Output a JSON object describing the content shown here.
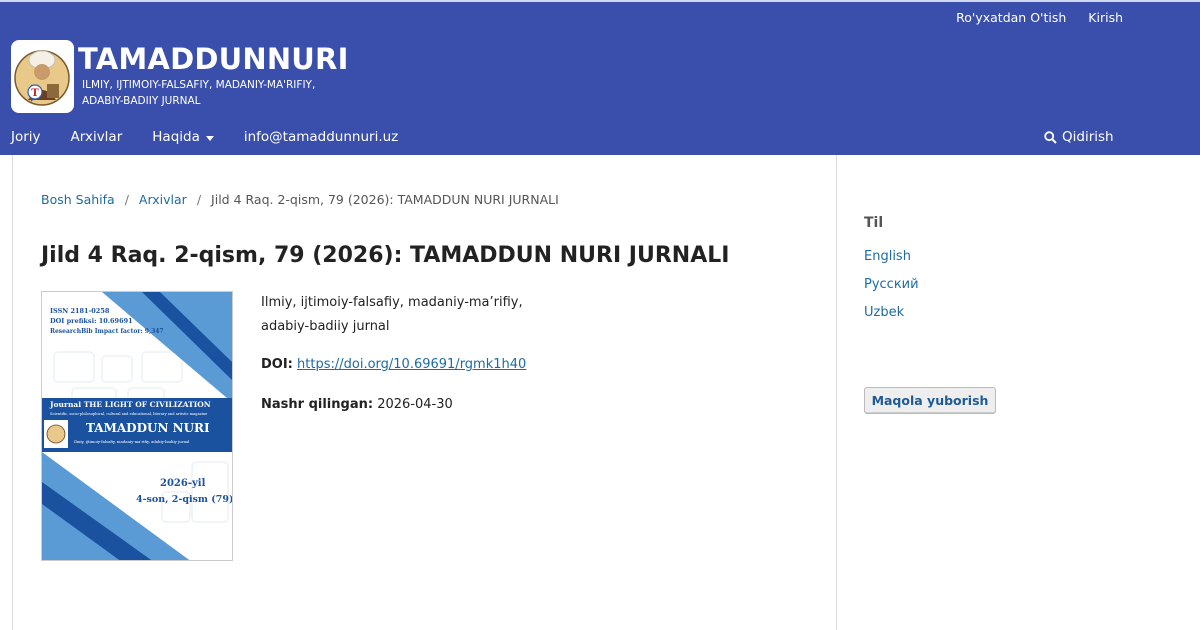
{
  "header": {
    "user_nav": [
      "Ro'yxatdan O'tish",
      "Kirish"
    ],
    "site_title": "TAMADDUNNURI",
    "subtitle_line1": "ILMIY, IJTIMOIY-FALSAFIY, MADANIY-MA'RIFIY,",
    "subtitle_line2": "ADABIY-BADIIY JURNAL",
    "nav": {
      "current": "Joriy",
      "archives": "Arxivlar",
      "about": "Haqida",
      "email": "info@tamaddunnuri.uz"
    },
    "search_label": "Qidirish"
  },
  "breadcrumb": {
    "home": "Bosh Sahifa",
    "archives": "Arxivlar",
    "current": "Jild 4 Raq. 2-qism, 79 (2026): TAMADDUN NURI JURNALI"
  },
  "issue": {
    "title": "Jild 4 Raq. 2-qism, 79 (2026): TAMADDUN NURI JURNALI",
    "description_line1": "Ilmiy, ijtimoiy-falsafiy, madaniy-ma’rifiy,",
    "description_line2": "adabiy-badiiy jurnal",
    "doi_label": "DOI:",
    "doi_link": "https://doi.org/10.69691/rgmk1h40",
    "published_label": "Nashr qilingan:",
    "published_date": "2026-04-30"
  },
  "cover": {
    "issn": "ISSN 2181-0258",
    "doi_prefix": "DOI prefiksi: 10.69691",
    "impact": "ResearchBib Impact factor: 9,347",
    "journal_line": "Journal THE LIGHT OF CIVILIZATION",
    "journal_subline": "Scientific, socio-philosophical, cultural and educational, literary and artistic magazine",
    "name": "TAMADDUN NURI",
    "name_subline": "Ilmiy, ijtimoiy-falsafiy, madaniy-ma'rifiy, adabiy-badiiy jurnal",
    "year": "2026-yil",
    "issue": "4-son, 2-qism (79)"
  },
  "sidebar": {
    "language_title": "Til",
    "languages": [
      "English",
      "Русский",
      "Uzbek"
    ],
    "submit_label": "Maqola yuborish"
  },
  "colors": {
    "header_bg": "#3a4fab",
    "link": "#1e6ba0",
    "cover_blue": "#1a52a0",
    "cover_light": "#5b9bd5"
  }
}
